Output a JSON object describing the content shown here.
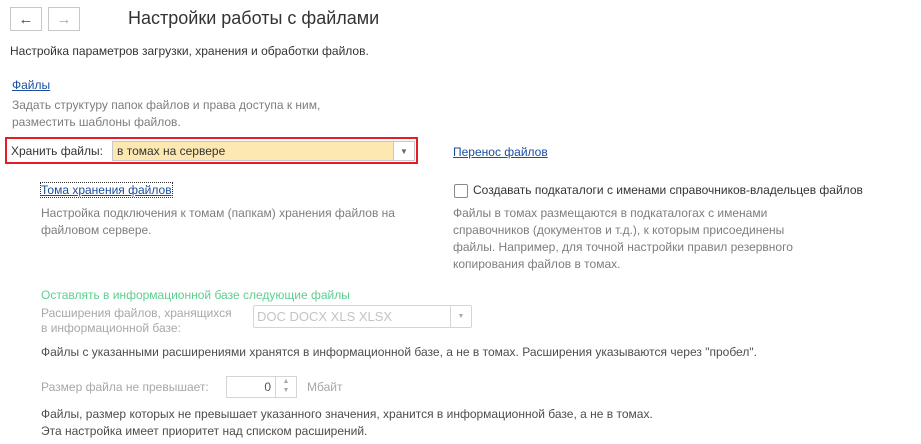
{
  "header": {
    "title": "Настройки работы с файлами",
    "back": "←",
    "forward": "→"
  },
  "intro": "Настройка параметров загрузки, хранения и обработки файлов.",
  "files": {
    "link": "Файлы",
    "desc1": "Задать структуру папок файлов и права доступа к ним,",
    "desc2": "разместить шаблоны файлов."
  },
  "store": {
    "label": "Хранить файлы:",
    "value": "в томах на сервере"
  },
  "transfer_link": "Перенос файлов",
  "volumes": {
    "link": "Тома хранения файлов",
    "desc1": "Настройка подключения к томам (папкам) хранения файлов на",
    "desc2": "файловом сервере."
  },
  "subdirs": {
    "label": "Создавать подкаталоги с именами справочников-владельцев файлов",
    "checked": false,
    "desc": [
      "Файлы в томах размещаются в подкаталогах с именами",
      "справочников (документов и т.д.), к которым присоединены",
      "файлы. Например, для точной настройки правил резервного",
      "копирования файлов в томах."
    ]
  },
  "keep": {
    "heading": "Оставлять в информационной базе следующие файлы",
    "ext_label1": "Расширения файлов, хранящихся",
    "ext_label2": "в информационной базе:",
    "ext_value": "DOC DOCX XLS XLSX",
    "ext_note": "Файлы с указанными расширениями хранятся в информационной базе, а не в томах. Расширения указываются через \"пробел\".",
    "size_label": "Размер файла не превышает:",
    "size_value": "0",
    "size_unit": "Мбайт",
    "size_note1": "Файлы, размер которых не превышает указанного значения, хранится в информационной базе, а не в томах.",
    "size_note2": "Эта настройка имеет приоритет над списком расширений."
  }
}
